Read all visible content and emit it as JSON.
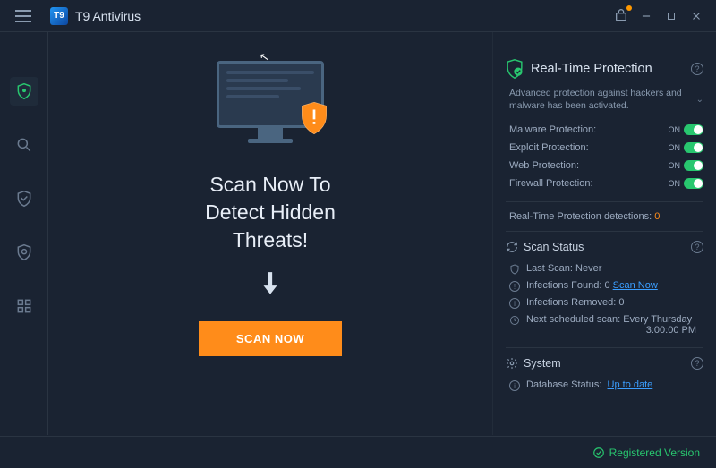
{
  "app": {
    "title": "T9 Antivirus",
    "logo_text": "T9"
  },
  "main": {
    "headline_l1": "Scan Now To",
    "headline_l2": "Detect Hidden",
    "headline_l3": "Threats!",
    "scan_button": "SCAN NOW"
  },
  "rtp": {
    "title": "Real-Time Protection",
    "message": "Advanced protection against hackers and malware has been activated.",
    "items": [
      {
        "label": "Malware Protection:",
        "state": "ON"
      },
      {
        "label": "Exploit Protection:",
        "state": "ON"
      },
      {
        "label": "Web Protection:",
        "state": "ON"
      },
      {
        "label": "Firewall Protection:",
        "state": "ON"
      }
    ],
    "detections_label": "Real-Time Protection detections:",
    "detections_count": "0"
  },
  "scan_status": {
    "title": "Scan Status",
    "last_scan_label": "Last Scan:",
    "last_scan_value": "Never",
    "infections_found_label": "Infections Found:",
    "infections_found_value": "0",
    "scan_now_link": "Scan Now",
    "infections_removed_label": "Infections Removed:",
    "infections_removed_value": "0",
    "next_scan_label": "Next scheduled scan:",
    "next_scan_value": "Every Thursday",
    "next_scan_time": "3:00:00 PM"
  },
  "system": {
    "title": "System",
    "db_label": "Database Status:",
    "db_value": "Up to date"
  },
  "footer": {
    "text": "Registered Version"
  }
}
